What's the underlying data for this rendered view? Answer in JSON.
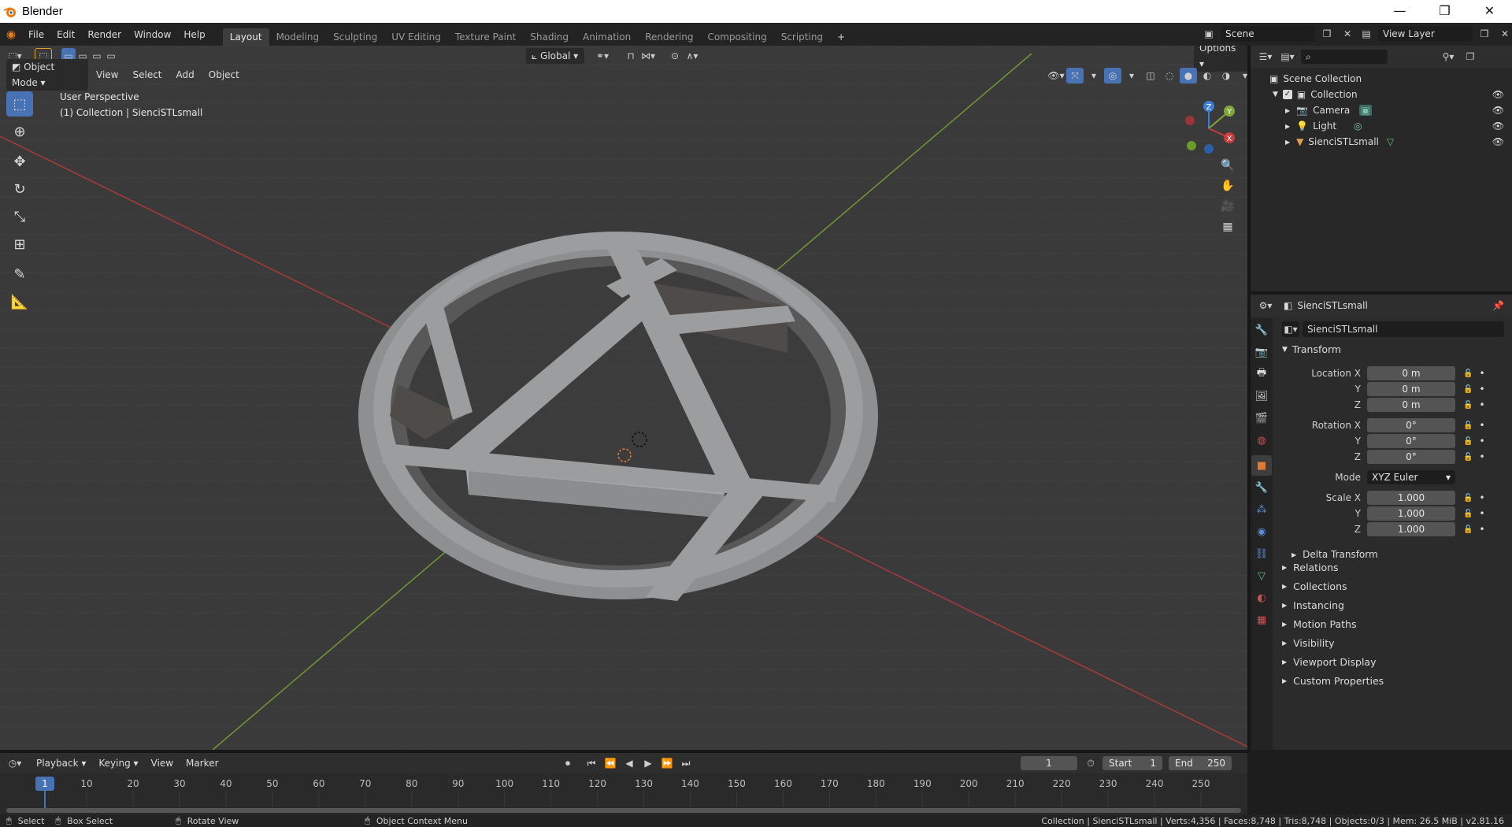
{
  "window": {
    "title": "Blender",
    "min": "—",
    "max": "❐",
    "close": "✕"
  },
  "menu": [
    "File",
    "Edit",
    "Render",
    "Window",
    "Help"
  ],
  "workspaces": [
    "Layout",
    "Modeling",
    "Sculpting",
    "UV Editing",
    "Texture Paint",
    "Shading",
    "Animation",
    "Rendering",
    "Compositing",
    "Scripting"
  ],
  "workspace_add": "+",
  "scene": "Scene",
  "view_layer": "View Layer",
  "viewport": {
    "mode": "Object Mode",
    "menus": [
      "View",
      "Select",
      "Add",
      "Object"
    ],
    "transform": "Global",
    "options": "Options",
    "perspective": "User Perspective",
    "collection_info": "(1) Collection | SienciSTLsmall",
    "gizmo_axes": {
      "x": "X",
      "y": "Y",
      "z": "Z"
    }
  },
  "outliner": {
    "root": "Scene Collection",
    "collection": "Collection",
    "items": [
      "Camera",
      "Light",
      "SienciSTLsmall"
    ]
  },
  "properties": {
    "object_header": "SienciSTLsmall",
    "object_name": "SienciSTLsmall",
    "transform_title": "Transform",
    "location": {
      "label": "Location X",
      "x": "0 m",
      "y": "0 m",
      "z": "0 m"
    },
    "rotation": {
      "label": "Rotation X",
      "x": "0°",
      "y": "0°",
      "z": "0°"
    },
    "mode_label": "Mode",
    "mode_value": "XYZ Euler",
    "scale": {
      "label": "Scale X",
      "x": "1.000",
      "y": "1.000",
      "z": "1.000"
    },
    "axis_y": "Y",
    "axis_z": "Z",
    "delta": "Delta Transform",
    "panels": [
      "Relations",
      "Collections",
      "Instancing",
      "Motion Paths",
      "Visibility",
      "Viewport Display",
      "Custom Properties"
    ]
  },
  "timeline": {
    "menus": [
      "Playback",
      "Keying",
      "View",
      "Marker"
    ],
    "current_frame": "1",
    "start_label": "Start",
    "start": "1",
    "end_label": "End",
    "end": "250",
    "ticks": [
      "1",
      "10",
      "20",
      "30",
      "40",
      "50",
      "60",
      "70",
      "80",
      "90",
      "100",
      "110",
      "120",
      "130",
      "140",
      "150",
      "160",
      "170",
      "180",
      "190",
      "200",
      "210",
      "220",
      "230",
      "240",
      "250"
    ]
  },
  "status": {
    "select": "Select",
    "box_select": "Box Select",
    "rotate": "Rotate View",
    "context": "Object Context Menu",
    "info": "Collection | SienciSTLsmall | Verts:4,356 | Faces:8,748 | Tris:8,748 | Objects:0/3 | Mem: 26.5 MiB | v2.81.16"
  },
  "colors": {
    "accent": "#4772b3",
    "x_axis": "#c83c3c",
    "y_axis": "#7fa838",
    "z_axis": "#3b7fd8",
    "object": "#9b9d9e",
    "object_orange": "#e07b2f"
  }
}
